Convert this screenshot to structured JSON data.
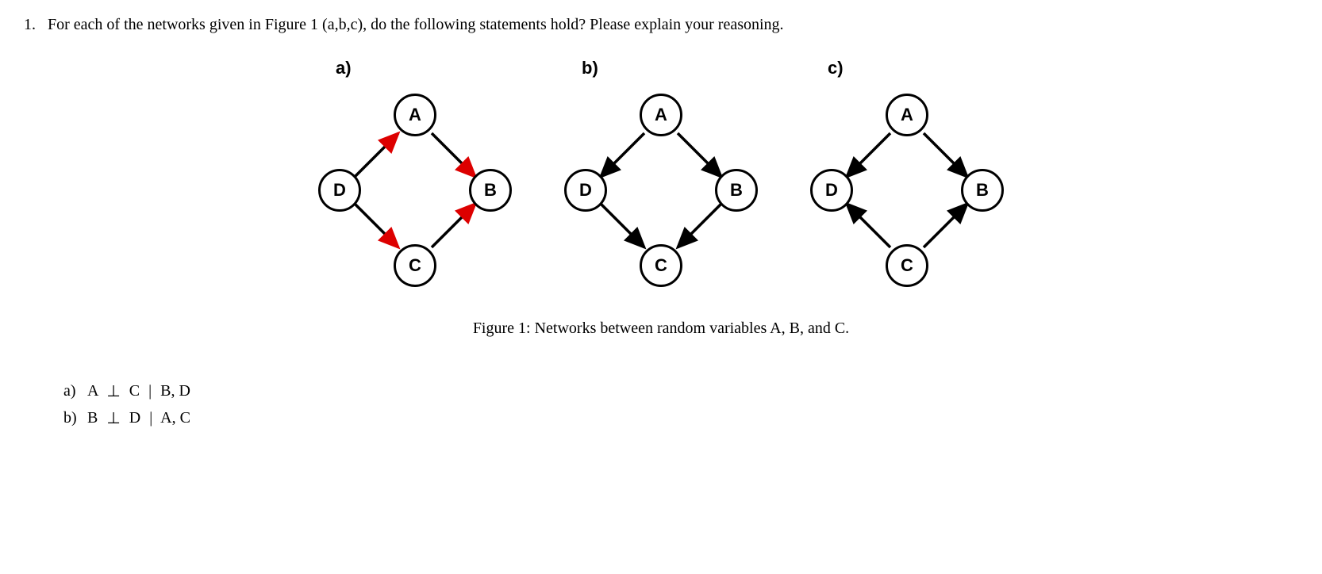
{
  "question": {
    "number": "1.",
    "text": "For each of the networks given in Figure 1 (a,b,c), do the following statements hold? Please explain your reasoning."
  },
  "networks": {
    "a": {
      "label": "a)",
      "nodes": {
        "top": "A",
        "left": "D",
        "right": "B",
        "bottom": "C"
      },
      "edges": [
        {
          "from": "left",
          "to": "top",
          "color": "red"
        },
        {
          "from": "top",
          "to": "right",
          "color": "red"
        },
        {
          "from": "left",
          "to": "bottom",
          "color": "red"
        },
        {
          "from": "bottom",
          "to": "right",
          "color": "red"
        }
      ]
    },
    "b": {
      "label": "b)",
      "nodes": {
        "top": "A",
        "left": "D",
        "right": "B",
        "bottom": "C"
      },
      "edges": [
        {
          "from": "top",
          "to": "left",
          "color": "black"
        },
        {
          "from": "top",
          "to": "right",
          "color": "black"
        },
        {
          "from": "left",
          "to": "bottom",
          "color": "black"
        },
        {
          "from": "right",
          "to": "bottom",
          "color": "black"
        }
      ]
    },
    "c": {
      "label": "c)",
      "nodes": {
        "top": "A",
        "left": "D",
        "right": "B",
        "bottom": "C"
      },
      "edges": [
        {
          "from": "top",
          "to": "left",
          "color": "black"
        },
        {
          "from": "top",
          "to": "right",
          "color": "black"
        },
        {
          "from": "bottom",
          "to": "left",
          "color": "black"
        },
        {
          "from": "bottom",
          "to": "right",
          "color": "black"
        }
      ]
    }
  },
  "caption": "Figure 1: Networks between random variables A, B, and C.",
  "subitems": {
    "a": {
      "label": "a)",
      "lhs": "A",
      "rhs": "C",
      "given": "B, D"
    },
    "b": {
      "label": "b)",
      "lhs": "B",
      "rhs": "D",
      "given": "A, C"
    }
  },
  "symbols": {
    "perp": "⊥",
    "bar": "|"
  }
}
